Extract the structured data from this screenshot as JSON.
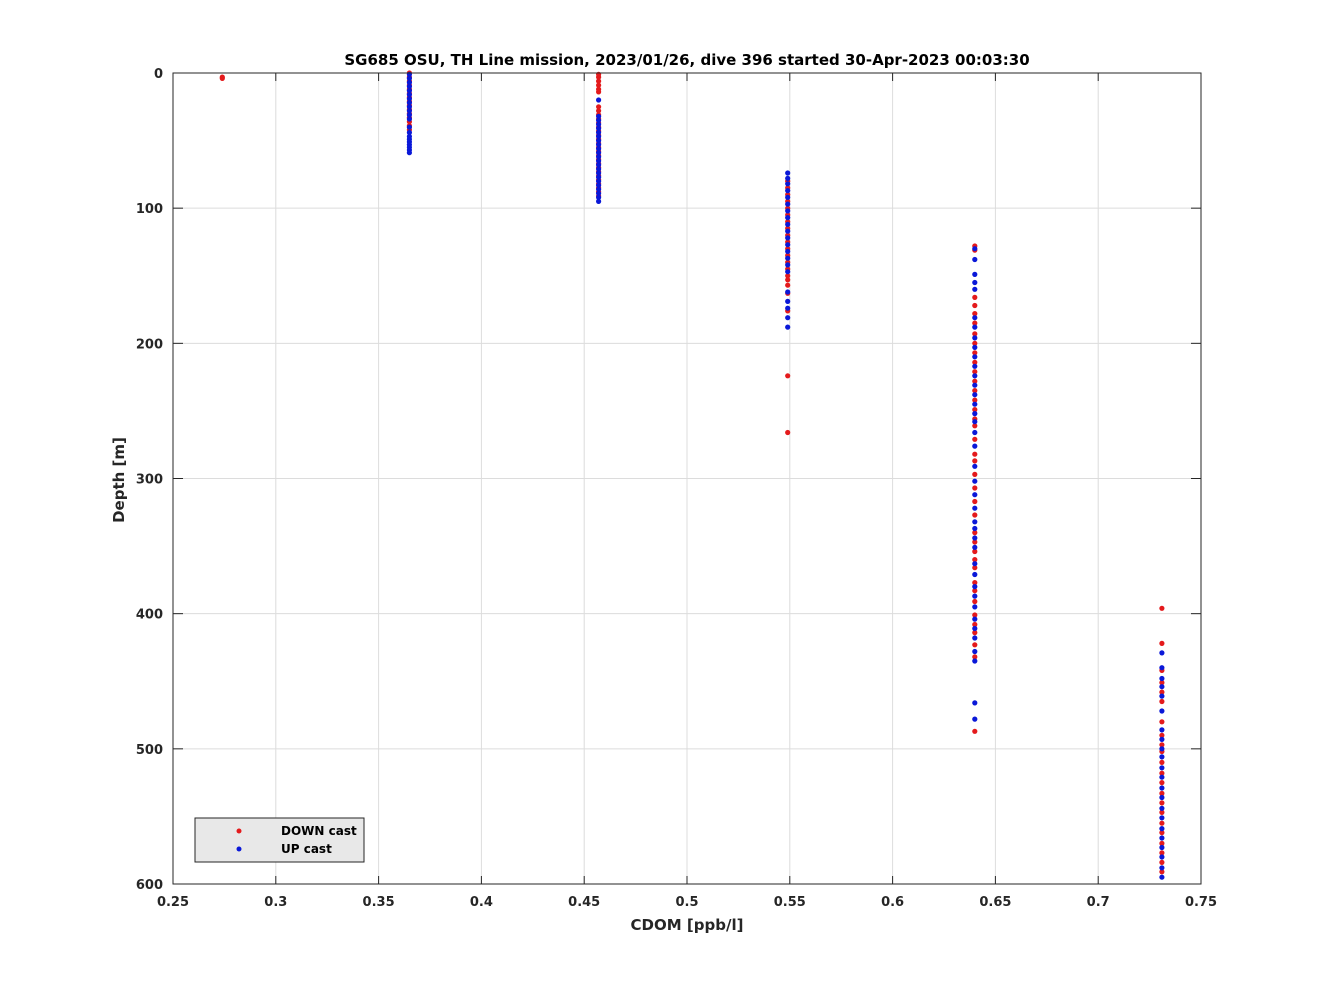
{
  "chart_data": {
    "type": "scatter",
    "title": "SG685 OSU, TH Line mission, 2023/01/26, dive 396 started 30-Apr-2023 00:03:30",
    "xlabel": "CDOM [ppb/l]",
    "ylabel": "Depth [m]",
    "xlim": [
      0.25,
      0.75
    ],
    "ylim": [
      0,
      600
    ],
    "y_reversed": true,
    "grid": true,
    "legend_position": "bottom-left",
    "xticks": [
      "0.25",
      "0.3",
      "0.35",
      "0.4",
      "0.45",
      "0.5",
      "0.55",
      "0.6",
      "0.65",
      "0.7",
      "0.75"
    ],
    "yticks": [
      "0",
      "100",
      "200",
      "300",
      "400",
      "500",
      "600"
    ],
    "series": [
      {
        "name": "DOWN cast",
        "color": "#e41a1c",
        "points": [
          [
            0.274,
            3
          ],
          [
            0.274,
            4
          ],
          [
            0.365,
            0
          ],
          [
            0.365,
            3
          ],
          [
            0.365,
            6
          ],
          [
            0.365,
            9
          ],
          [
            0.365,
            12
          ],
          [
            0.365,
            15
          ],
          [
            0.365,
            18
          ],
          [
            0.365,
            21
          ],
          [
            0.365,
            24
          ],
          [
            0.365,
            27
          ],
          [
            0.365,
            30
          ],
          [
            0.365,
            33
          ],
          [
            0.365,
            36
          ],
          [
            0.365,
            39
          ],
          [
            0.365,
            42
          ],
          [
            0.457,
            1
          ],
          [
            0.457,
            3
          ],
          [
            0.457,
            6
          ],
          [
            0.457,
            9
          ],
          [
            0.457,
            12
          ],
          [
            0.457,
            14
          ],
          [
            0.457,
            25
          ],
          [
            0.457,
            28
          ],
          [
            0.457,
            31
          ],
          [
            0.457,
            34
          ],
          [
            0.457,
            37
          ],
          [
            0.457,
            40
          ],
          [
            0.457,
            43
          ],
          [
            0.457,
            46
          ],
          [
            0.457,
            49
          ],
          [
            0.457,
            52
          ],
          [
            0.457,
            55
          ],
          [
            0.457,
            58
          ],
          [
            0.457,
            61
          ],
          [
            0.457,
            64
          ],
          [
            0.457,
            67
          ],
          [
            0.457,
            70
          ],
          [
            0.457,
            73
          ],
          [
            0.457,
            76
          ],
          [
            0.457,
            79
          ],
          [
            0.457,
            82
          ],
          [
            0.457,
            85
          ],
          [
            0.457,
            88
          ],
          [
            0.457,
            91
          ],
          [
            0.549,
            80
          ],
          [
            0.549,
            85
          ],
          [
            0.549,
            90
          ],
          [
            0.549,
            95
          ],
          [
            0.549,
            100
          ],
          [
            0.549,
            105
          ],
          [
            0.549,
            110
          ],
          [
            0.549,
            115
          ],
          [
            0.549,
            120
          ],
          [
            0.549,
            125
          ],
          [
            0.549,
            130
          ],
          [
            0.549,
            135
          ],
          [
            0.549,
            140
          ],
          [
            0.549,
            145
          ],
          [
            0.549,
            150
          ],
          [
            0.549,
            153
          ],
          [
            0.549,
            157
          ],
          [
            0.549,
            163
          ],
          [
            0.549,
            176
          ],
          [
            0.549,
            224
          ],
          [
            0.549,
            266
          ],
          [
            0.64,
            128
          ],
          [
            0.64,
            131
          ],
          [
            0.64,
            166
          ],
          [
            0.64,
            172
          ],
          [
            0.64,
            178
          ],
          [
            0.64,
            185
          ],
          [
            0.64,
            193
          ],
          [
            0.64,
            200
          ],
          [
            0.64,
            207
          ],
          [
            0.64,
            214
          ],
          [
            0.64,
            221
          ],
          [
            0.64,
            228
          ],
          [
            0.64,
            235
          ],
          [
            0.64,
            242
          ],
          [
            0.64,
            249
          ],
          [
            0.64,
            256
          ],
          [
            0.64,
            261
          ],
          [
            0.64,
            271
          ],
          [
            0.64,
            282
          ],
          [
            0.64,
            287
          ],
          [
            0.64,
            297
          ],
          [
            0.64,
            307
          ],
          [
            0.64,
            317
          ],
          [
            0.64,
            327
          ],
          [
            0.64,
            340
          ],
          [
            0.64,
            347
          ],
          [
            0.64,
            354
          ],
          [
            0.64,
            360
          ],
          [
            0.64,
            366
          ],
          [
            0.64,
            377
          ],
          [
            0.64,
            383
          ],
          [
            0.64,
            391
          ],
          [
            0.64,
            401
          ],
          [
            0.64,
            408
          ],
          [
            0.64,
            414
          ],
          [
            0.64,
            423
          ],
          [
            0.64,
            432
          ],
          [
            0.64,
            487
          ],
          [
            0.731,
            396
          ],
          [
            0.731,
            422
          ],
          [
            0.731,
            442
          ],
          [
            0.731,
            451
          ],
          [
            0.731,
            458
          ],
          [
            0.731,
            465
          ],
          [
            0.731,
            480
          ],
          [
            0.731,
            490
          ],
          [
            0.731,
            497
          ],
          [
            0.731,
            502
          ],
          [
            0.731,
            510
          ],
          [
            0.731,
            518
          ],
          [
            0.731,
            525
          ],
          [
            0.731,
            533
          ],
          [
            0.731,
            540
          ],
          [
            0.731,
            547
          ],
          [
            0.731,
            555
          ],
          [
            0.731,
            562
          ],
          [
            0.731,
            570
          ],
          [
            0.731,
            577
          ],
          [
            0.731,
            584
          ],
          [
            0.731,
            591
          ]
        ]
      },
      {
        "name": "UP cast",
        "color": "#0a18d8",
        "points": [
          [
            0.365,
            1
          ],
          [
            0.365,
            4
          ],
          [
            0.365,
            7
          ],
          [
            0.365,
            10
          ],
          [
            0.365,
            13
          ],
          [
            0.365,
            16
          ],
          [
            0.365,
            19
          ],
          [
            0.365,
            22
          ],
          [
            0.365,
            25
          ],
          [
            0.365,
            28
          ],
          [
            0.365,
            31
          ],
          [
            0.365,
            34
          ],
          [
            0.365,
            40
          ],
          [
            0.365,
            44
          ],
          [
            0.365,
            47
          ],
          [
            0.365,
            49
          ],
          [
            0.365,
            51
          ],
          [
            0.365,
            53
          ],
          [
            0.365,
            55
          ],
          [
            0.365,
            57
          ],
          [
            0.365,
            59
          ],
          [
            0.457,
            20
          ],
          [
            0.457,
            32
          ],
          [
            0.457,
            35
          ],
          [
            0.457,
            38
          ],
          [
            0.457,
            41
          ],
          [
            0.457,
            44
          ],
          [
            0.457,
            47
          ],
          [
            0.457,
            50
          ],
          [
            0.457,
            53
          ],
          [
            0.457,
            56
          ],
          [
            0.457,
            59
          ],
          [
            0.457,
            62
          ],
          [
            0.457,
            65
          ],
          [
            0.457,
            68
          ],
          [
            0.457,
            71
          ],
          [
            0.457,
            74
          ],
          [
            0.457,
            77
          ],
          [
            0.457,
            80
          ],
          [
            0.457,
            83
          ],
          [
            0.457,
            86
          ],
          [
            0.457,
            89
          ],
          [
            0.457,
            92
          ],
          [
            0.457,
            95
          ],
          [
            0.549,
            74
          ],
          [
            0.549,
            78
          ],
          [
            0.549,
            82
          ],
          [
            0.549,
            87
          ],
          [
            0.549,
            92
          ],
          [
            0.549,
            97
          ],
          [
            0.549,
            102
          ],
          [
            0.549,
            107
          ],
          [
            0.549,
            112
          ],
          [
            0.549,
            117
          ],
          [
            0.549,
            122
          ],
          [
            0.549,
            127
          ],
          [
            0.549,
            132
          ],
          [
            0.549,
            137
          ],
          [
            0.549,
            142
          ],
          [
            0.549,
            147
          ],
          [
            0.549,
            162
          ],
          [
            0.549,
            169
          ],
          [
            0.549,
            174
          ],
          [
            0.549,
            181
          ],
          [
            0.549,
            188
          ],
          [
            0.64,
            130
          ],
          [
            0.64,
            138
          ],
          [
            0.64,
            149
          ],
          [
            0.64,
            155
          ],
          [
            0.64,
            160
          ],
          [
            0.64,
            181
          ],
          [
            0.64,
            188
          ],
          [
            0.64,
            196
          ],
          [
            0.64,
            203
          ],
          [
            0.64,
            210
          ],
          [
            0.64,
            217
          ],
          [
            0.64,
            224
          ],
          [
            0.64,
            231
          ],
          [
            0.64,
            238
          ],
          [
            0.64,
            245
          ],
          [
            0.64,
            252
          ],
          [
            0.64,
            258
          ],
          [
            0.64,
            266
          ],
          [
            0.64,
            276
          ],
          [
            0.64,
            291
          ],
          [
            0.64,
            302
          ],
          [
            0.64,
            312
          ],
          [
            0.64,
            322
          ],
          [
            0.64,
            332
          ],
          [
            0.64,
            337
          ],
          [
            0.64,
            344
          ],
          [
            0.64,
            351
          ],
          [
            0.64,
            363
          ],
          [
            0.64,
            371
          ],
          [
            0.64,
            380
          ],
          [
            0.64,
            387
          ],
          [
            0.64,
            395
          ],
          [
            0.64,
            404
          ],
          [
            0.64,
            411
          ],
          [
            0.64,
            418
          ],
          [
            0.64,
            428
          ],
          [
            0.64,
            435
          ],
          [
            0.64,
            466
          ],
          [
            0.64,
            478
          ],
          [
            0.731,
            429
          ],
          [
            0.731,
            440
          ],
          [
            0.731,
            448
          ],
          [
            0.731,
            454
          ],
          [
            0.731,
            461
          ],
          [
            0.731,
            472
          ],
          [
            0.731,
            486
          ],
          [
            0.731,
            493
          ],
          [
            0.731,
            500
          ],
          [
            0.731,
            506
          ],
          [
            0.731,
            514
          ],
          [
            0.731,
            521
          ],
          [
            0.731,
            529
          ],
          [
            0.731,
            536
          ],
          [
            0.731,
            544
          ],
          [
            0.731,
            551
          ],
          [
            0.731,
            559
          ],
          [
            0.731,
            566
          ],
          [
            0.731,
            573
          ],
          [
            0.731,
            580
          ],
          [
            0.731,
            588
          ],
          [
            0.731,
            595
          ]
        ]
      }
    ]
  }
}
